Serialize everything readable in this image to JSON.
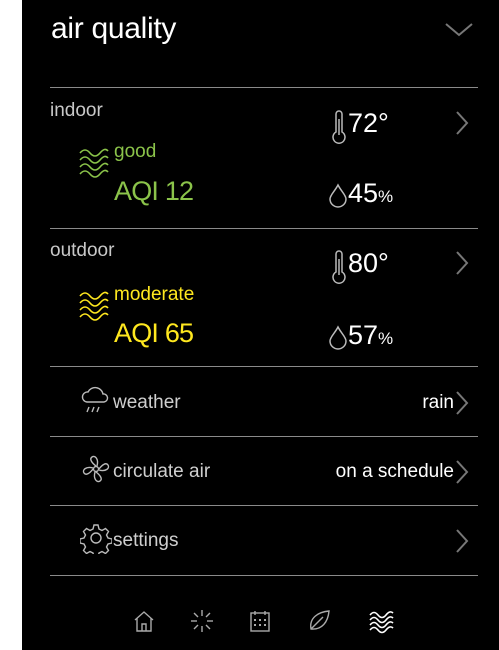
{
  "header": {
    "title": "air quality",
    "collapse_icon": "chevron-down-icon"
  },
  "indoor": {
    "label": "indoor",
    "status": "good",
    "aqi": "AQI 12",
    "temperature": "72°",
    "humidity_value": "45",
    "humidity_unit": "%",
    "status_color": "#8bc34a"
  },
  "outdoor": {
    "label": "outdoor",
    "status": "moderate",
    "aqi": "AQI 65",
    "temperature": "80°",
    "humidity_value": "57",
    "humidity_unit": "%",
    "status_color": "#ffe81f"
  },
  "rows": [
    {
      "label": "weather",
      "value": "rain",
      "icon": "cloud-rain-icon"
    },
    {
      "label": "circulate air",
      "value": "on a schedule",
      "icon": "fan-icon"
    },
    {
      "label": "settings",
      "value": "",
      "icon": "gear-icon"
    }
  ],
  "nav": [
    "home-icon",
    "fan-sparkle-icon",
    "calendar-icon",
    "leaf-icon",
    "air-quality-icon"
  ]
}
